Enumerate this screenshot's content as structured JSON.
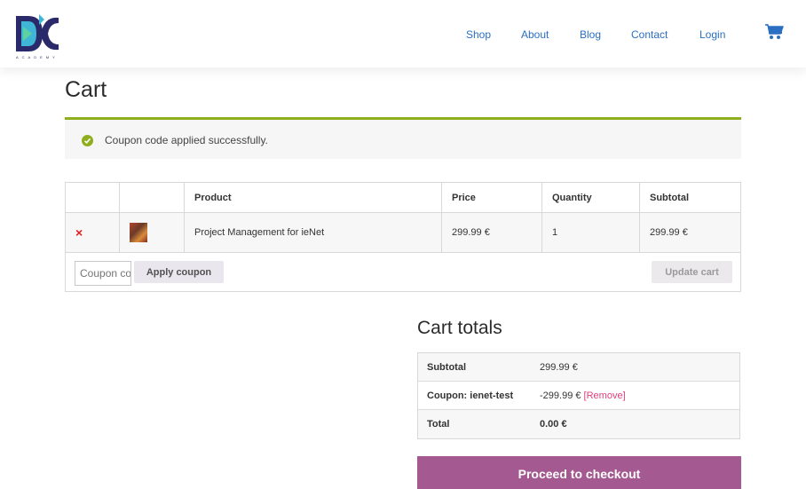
{
  "brand": {
    "logo_letters": "DC",
    "logo_sub": "ACADEMY",
    "primary": "#2b6fc2"
  },
  "nav": {
    "items": [
      "Shop",
      "About",
      "Blog",
      "Contact",
      "Login"
    ]
  },
  "page": {
    "title": "Cart"
  },
  "notice": {
    "message": "Coupon code applied successfully.",
    "color": "#8fae1b"
  },
  "cart": {
    "headers": {
      "product": "Product",
      "price": "Price",
      "quantity": "Quantity",
      "subtotal": "Subtotal"
    },
    "items": [
      {
        "remove": "×",
        "product": "Project Management for ieNet",
        "price": "299.99 €",
        "quantity": "1",
        "subtotal": "299.99 €"
      }
    ],
    "coupon_placeholder": "Coupon code",
    "apply_label": "Apply coupon",
    "update_label": "Update cart"
  },
  "totals": {
    "title": "Cart totals",
    "subtotal_label": "Subtotal",
    "subtotal_value": "299.99 €",
    "coupon_label": "Coupon: ienet-test",
    "coupon_value": "-299.99 €",
    "coupon_remove": "[Remove]",
    "total_label": "Total",
    "total_value": "0.00 €"
  },
  "checkout": {
    "label": "Proceed to checkout",
    "color": "#a45a91"
  }
}
